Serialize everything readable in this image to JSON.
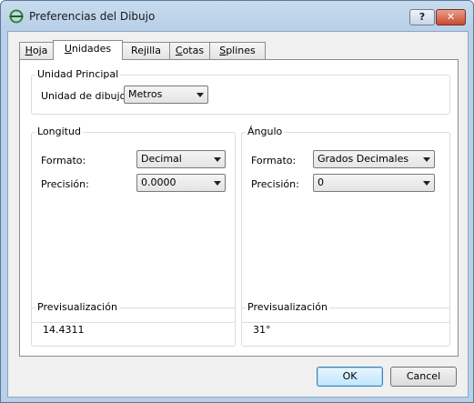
{
  "window": {
    "title": "Preferencias del Dibujo",
    "help_label": "?",
    "close_label": "✕"
  },
  "tabs": [
    {
      "label": "Hoja",
      "mnemonic_prefix": "",
      "mnemonic": "H",
      "rest": "oja",
      "active": false
    },
    {
      "label": "Unidades",
      "mnemonic_prefix": "",
      "mnemonic": "U",
      "rest": "nidades",
      "active": true
    },
    {
      "label": "Rejilla",
      "mnemonic_prefix": "Re",
      "mnemonic": "j",
      "rest": "illa",
      "active": false
    },
    {
      "label": "Cotas",
      "mnemonic_prefix": "",
      "mnemonic": "C",
      "rest": "otas",
      "active": false
    },
    {
      "label": "Splines",
      "mnemonic_prefix": "",
      "mnemonic": "S",
      "rest": "plines",
      "active": false
    }
  ],
  "unidad_principal": {
    "group_label": "Unidad Principal",
    "unit_label": "Unidad de dibujo:",
    "unit_value": "Metros"
  },
  "longitud": {
    "group_label": "Longitud",
    "format_label": "Formato:",
    "format_value": "Decimal",
    "precision_label": "Precisión:",
    "precision_value": "0.0000"
  },
  "angulo": {
    "group_label": "Ángulo",
    "format_label": "Formato:",
    "format_value": "Grados Decimales",
    "precision_label": "Precisión:",
    "precision_value": "0"
  },
  "preview_longitud": {
    "group_label": "Previsualización",
    "value": "14.4311"
  },
  "preview_angulo": {
    "group_label": "Previsualización",
    "value": "31°"
  },
  "buttons": {
    "ok": "OK",
    "cancel": "Cancel"
  },
  "colors": {
    "titlebar": "#b8d0e8",
    "close_button": "#c94a2e",
    "default_button": "#bee6fd"
  },
  "icons": {
    "app": "app-logo-icon",
    "dropdown": "chevron-down-icon"
  }
}
